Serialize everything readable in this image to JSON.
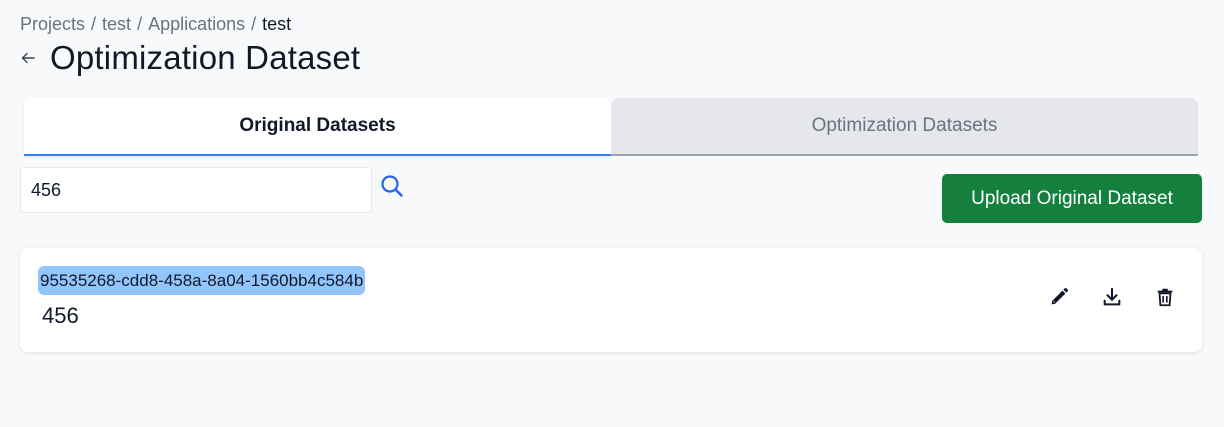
{
  "breadcrumb": {
    "items": [
      "Projects",
      "test",
      "Applications",
      "test"
    ],
    "separator": "/"
  },
  "header": {
    "title": "Optimization Dataset",
    "back_icon": "arrow-left-icon"
  },
  "tabs": [
    {
      "label": "Original Datasets",
      "active": true
    },
    {
      "label": "Optimization Datasets",
      "active": false
    }
  ],
  "search": {
    "value": "456",
    "icon": "search-icon"
  },
  "toolbar": {
    "upload_label": "Upload Original Dataset"
  },
  "datasets": [
    {
      "id": "95535268-cdd8-458a-8a04-1560bb4c584b",
      "name": "456",
      "actions": [
        "pencil-icon",
        "download-icon",
        "trash-icon"
      ]
    }
  ],
  "colors": {
    "accent": "#3b82f6",
    "primary_button": "#15803d",
    "selection_highlight": "#93c5fd",
    "background": "#f8f9fb"
  }
}
